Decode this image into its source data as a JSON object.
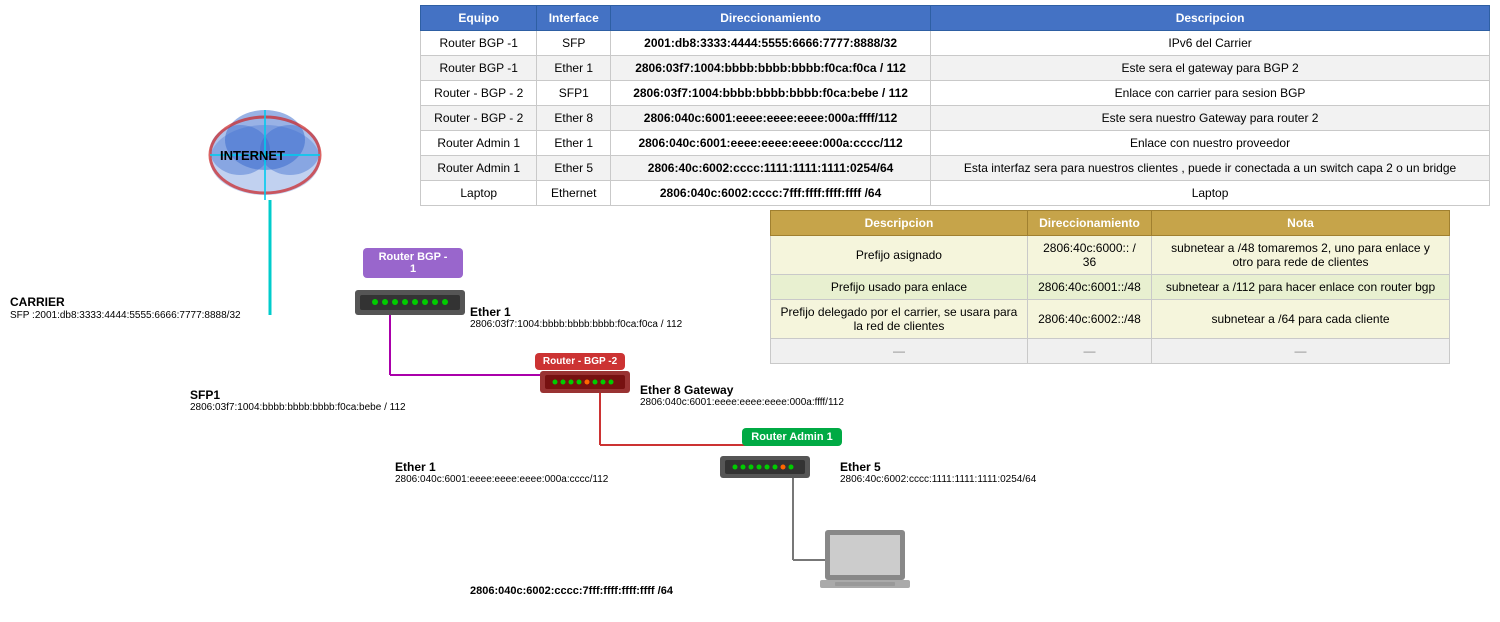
{
  "mainTable": {
    "headers": [
      "Equipo",
      "Interface",
      "Direccionamiento",
      "Descripcion"
    ],
    "rows": [
      {
        "equipo": "Router BGP -1",
        "interface": "SFP",
        "direccionamiento": "2001:db8:3333:4444:5555:6666:7777:8888/32",
        "descripcion": "IPv6 del Carrier"
      },
      {
        "equipo": "Router BGP -1",
        "interface": "Ether 1",
        "direccionamiento": "2806:03f7:1004:bbbb:bbbb:bbbb:f0ca:f0ca / 112",
        "descripcion": "Este sera el gateway para BGP 2"
      },
      {
        "equipo": "Router - BGP - 2",
        "interface": "SFP1",
        "direccionamiento": "2806:03f7:1004:bbbb:bbbb:bbbb:f0ca:bebe / 112",
        "descripcion": "Enlace con carrier para sesion BGP"
      },
      {
        "equipo": "Router - BGP - 2",
        "interface": "Ether 8",
        "direccionamiento": "2806:040c:6001:eeee:eeee:eeee:000a:ffff/112",
        "descripcion": "Este sera nuestro Gateway para router 2"
      },
      {
        "equipo": "Router Admin 1",
        "interface": "Ether 1",
        "direccionamiento": "2806:040c:6001:eeee:eeee:eeee:000a:cccc/112",
        "descripcion": "Enlace con nuestro proveedor"
      },
      {
        "equipo": "Router Admin 1",
        "interface": "Ether 5",
        "direccionamiento": "2806:40c:6002:cccc:1111:1111:1111:0254/64",
        "descripcion": "Esta interfaz sera para nuestros clientes , puede ir conectada a un switch capa 2 o un bridge"
      },
      {
        "equipo": "Laptop",
        "interface": "Ethernet",
        "direccionamiento": "2806:040c:6002:cccc:7fff:ffff:ffff:ffff /64",
        "descripcion": "Laptop"
      }
    ]
  },
  "secondaryTable": {
    "headers": [
      "Descripcion",
      "Direccionamiento",
      "Nota"
    ],
    "rows": [
      {
        "descripcion": "Prefijo asignado",
        "direccionamiento": "2806:40c:6000:: / 36",
        "nota": "subnetear a /48  tomaremos 2, uno para enlace y otro para rede de clientes"
      },
      {
        "descripcion": "Prefijo usado para enlace",
        "direccionamiento": "2806:40c:6001::/48",
        "nota": "subnetear a /112 para hacer enlace con router bgp"
      },
      {
        "descripcion": "Prefijo delegado por el carrier, se usara para la red de clientes",
        "direccionamiento": "2806:40c:6002::/48",
        "nota": "subnetear a /64 para cada cliente"
      },
      {
        "descripcion": "—",
        "direccionamiento": "—",
        "nota": "—"
      }
    ]
  },
  "diagram": {
    "internetLabel": "INTERNET",
    "carrierLabel": "CARRIER",
    "carrierAddr": "SFP :2001:db8:3333:4444:5555:6666:7777:8888/32",
    "routerBGP1": "Router BGP -\n1",
    "routerBGP2": "Router - BGP -2",
    "routerAdmin1": "Router Admin 1",
    "ether1LabelBGP1": "Ether 1",
    "ether1AddrBGP1": "2806:03f7:1004:bbbb:bbbb:bbbb:f0ca:f0ca / 112",
    "sfp1Label": "SFP1",
    "sfp1Addr": "2806:03f7:1004:bbbb:bbbb:bbbb:f0ca:bebe / 112",
    "ether8Label": "Ether 8 Gateway",
    "ether8Addr": "2806:040c:6001:eeee:eeee:eeee:000a:ffff/112",
    "ether1LabelAdmin": "Ether 1",
    "ether1AddrAdmin": "2806:040c:6001:eeee:eeee:eeee:000a:cccc/112",
    "ether5Label": "Ether 5",
    "ether5Addr": "2806:40c:6002:cccc:1111:1111:1111:0254/64",
    "laptopAddr": "2806:040c:6002:cccc:7fff:ffff:ffff:ffff /64"
  }
}
